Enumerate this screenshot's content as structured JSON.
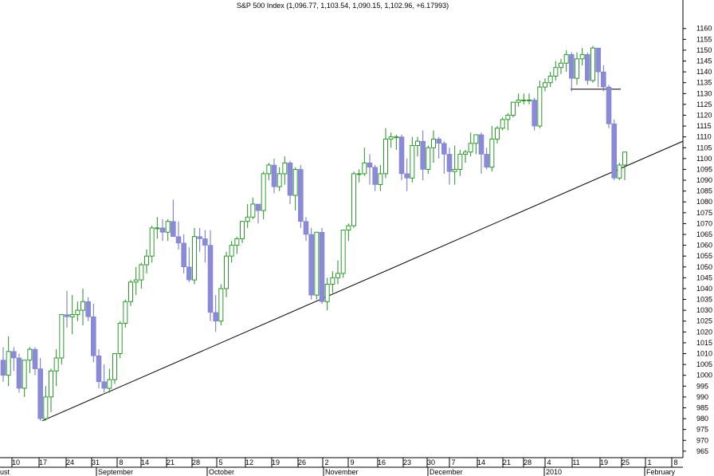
{
  "chart_data": {
    "type": "candlestick",
    "title": "S&P 500 Index (1,096.77, 1,103.54, 1,090.15, 1,102.96, +6.17993)",
    "ylim": [
      962,
      1168
    ],
    "y_ticks": [
      965,
      970,
      975,
      980,
      985,
      990,
      995,
      1000,
      1005,
      1010,
      1015,
      1020,
      1025,
      1030,
      1035,
      1040,
      1045,
      1050,
      1055,
      1060,
      1065,
      1070,
      1075,
      1080,
      1085,
      1090,
      1095,
      1100,
      1105,
      1110,
      1115,
      1120,
      1125,
      1130,
      1135,
      1140,
      1145,
      1150,
      1155,
      1160
    ],
    "x_day_labels": [
      "10",
      "17",
      "24",
      "31",
      "8",
      "14",
      "21",
      "28",
      "5",
      "12",
      "19",
      "26",
      "2",
      "9",
      "16",
      "23",
      "30",
      "7",
      "14",
      "21",
      "28",
      "4",
      "11",
      "19",
      "25",
      "1",
      "8"
    ],
    "x_month_labels": [
      "ust",
      "September",
      "October",
      "November",
      "December",
      "2010",
      "February"
    ],
    "candles": [
      {
        "o": 1007,
        "h": 1013,
        "l": 997,
        "c": 1000
      },
      {
        "o": 1000,
        "h": 1018,
        "l": 995,
        "c": 1011
      },
      {
        "o": 1011,
        "h": 1013,
        "l": 1002,
        "c": 1008
      },
      {
        "o": 1008,
        "h": 1010,
        "l": 992,
        "c": 994
      },
      {
        "o": 994,
        "h": 1007,
        "l": 990,
        "c": 1007
      },
      {
        "o": 1007,
        "h": 1013,
        "l": 1001,
        "c": 1012
      },
      {
        "o": 1012,
        "h": 1013,
        "l": 1000,
        "c": 1003
      },
      {
        "o": 1003,
        "h": 1008,
        "l": 979,
        "c": 980
      },
      {
        "o": 980,
        "h": 995,
        "l": 979,
        "c": 990
      },
      {
        "o": 990,
        "h": 1003,
        "l": 983,
        "c": 1002
      },
      {
        "o": 1002,
        "h": 1012,
        "l": 995,
        "c": 1008
      },
      {
        "o": 1008,
        "h": 1028,
        "l": 1005,
        "c": 1028
      },
      {
        "o": 1028,
        "h": 1039,
        "l": 1022,
        "c": 1027
      },
      {
        "o": 1027,
        "h": 1037,
        "l": 1019,
        "c": 1028
      },
      {
        "o": 1028,
        "h": 1034,
        "l": 1025,
        "c": 1030
      },
      {
        "o": 1030,
        "h": 1040,
        "l": 1023,
        "c": 1034
      },
      {
        "o": 1034,
        "h": 1036,
        "l": 1025,
        "c": 1027
      },
      {
        "o": 1027,
        "h": 1033,
        "l": 1006,
        "c": 1009
      },
      {
        "o": 1009,
        "h": 1012,
        "l": 994,
        "c": 997
      },
      {
        "o": 997,
        "h": 1005,
        "l": 992,
        "c": 994
      },
      {
        "o": 994,
        "h": 1003,
        "l": 992,
        "c": 998
      },
      {
        "o": 998,
        "h": 1010,
        "l": 996,
        "c": 1010
      },
      {
        "o": 1010,
        "h": 1025,
        "l": 1008,
        "c": 1024
      },
      {
        "o": 1024,
        "h": 1035,
        "l": 1022,
        "c": 1034
      },
      {
        "o": 1034,
        "h": 1044,
        "l": 1032,
        "c": 1043
      },
      {
        "o": 1043,
        "h": 1050,
        "l": 1037,
        "c": 1044
      },
      {
        "o": 1044,
        "h": 1052,
        "l": 1040,
        "c": 1051
      },
      {
        "o": 1051,
        "h": 1058,
        "l": 1047,
        "c": 1055
      },
      {
        "o": 1055,
        "h": 1069,
        "l": 1052,
        "c": 1068
      },
      {
        "o": 1068,
        "h": 1073,
        "l": 1063,
        "c": 1068
      },
      {
        "o": 1068,
        "h": 1072,
        "l": 1062,
        "c": 1066
      },
      {
        "o": 1066,
        "h": 1072,
        "l": 1062,
        "c": 1071
      },
      {
        "o": 1071,
        "h": 1081,
        "l": 1064,
        "c": 1064
      },
      {
        "o": 1064,
        "h": 1071,
        "l": 1058,
        "c": 1061
      },
      {
        "o": 1061,
        "h": 1065,
        "l": 1047,
        "c": 1050
      },
      {
        "o": 1050,
        "h": 1059,
        "l": 1043,
        "c": 1044
      },
      {
        "o": 1044,
        "h": 1068,
        "l": 1042,
        "c": 1064
      },
      {
        "o": 1064,
        "h": 1068,
        "l": 1057,
        "c": 1063
      },
      {
        "o": 1063,
        "h": 1067,
        "l": 1052,
        "c": 1060
      },
      {
        "o": 1060,
        "h": 1067,
        "l": 1025,
        "c": 1029
      },
      {
        "o": 1029,
        "h": 1037,
        "l": 1020,
        "c": 1025
      },
      {
        "o": 1025,
        "h": 1042,
        "l": 1023,
        "c": 1040
      },
      {
        "o": 1040,
        "h": 1057,
        "l": 1036,
        "c": 1055
      },
      {
        "o": 1055,
        "h": 1062,
        "l": 1052,
        "c": 1060
      },
      {
        "o": 1060,
        "h": 1064,
        "l": 1056,
        "c": 1063
      },
      {
        "o": 1063,
        "h": 1071,
        "l": 1061,
        "c": 1071
      },
      {
        "o": 1071,
        "h": 1079,
        "l": 1068,
        "c": 1073
      },
      {
        "o": 1073,
        "h": 1082,
        "l": 1072,
        "c": 1079
      },
      {
        "o": 1079,
        "h": 1079,
        "l": 1070,
        "c": 1076
      },
      {
        "o": 1076,
        "h": 1094,
        "l": 1072,
        "c": 1093
      },
      {
        "o": 1093,
        "h": 1098,
        "l": 1090,
        "c": 1097
      },
      {
        "o": 1097,
        "h": 1100,
        "l": 1084,
        "c": 1087
      },
      {
        "o": 1087,
        "h": 1096,
        "l": 1085,
        "c": 1093
      },
      {
        "o": 1093,
        "h": 1101,
        "l": 1088,
        "c": 1098
      },
      {
        "o": 1098,
        "h": 1099,
        "l": 1079,
        "c": 1083
      },
      {
        "o": 1083,
        "h": 1096,
        "l": 1076,
        "c": 1095
      },
      {
        "o": 1095,
        "h": 1097,
        "l": 1068,
        "c": 1071
      },
      {
        "o": 1071,
        "h": 1073,
        "l": 1062,
        "c": 1065
      },
      {
        "o": 1065,
        "h": 1068,
        "l": 1035,
        "c": 1037
      },
      {
        "o": 1037,
        "h": 1066,
        "l": 1035,
        "c": 1066
      },
      {
        "o": 1066,
        "h": 1068,
        "l": 1033,
        "c": 1034
      },
      {
        "o": 1034,
        "h": 1045,
        "l": 1030,
        "c": 1042
      },
      {
        "o": 1042,
        "h": 1048,
        "l": 1038,
        "c": 1045
      },
      {
        "o": 1045,
        "h": 1053,
        "l": 1042,
        "c": 1047
      },
      {
        "o": 1047,
        "h": 1066,
        "l": 1045,
        "c": 1067
      },
      {
        "o": 1067,
        "h": 1070,
        "l": 1062,
        "c": 1069
      },
      {
        "o": 1069,
        "h": 1094,
        "l": 1068,
        "c": 1093
      },
      {
        "o": 1093,
        "h": 1095,
        "l": 1089,
        "c": 1093
      },
      {
        "o": 1093,
        "h": 1105,
        "l": 1092,
        "c": 1098
      },
      {
        "o": 1098,
        "h": 1102,
        "l": 1088,
        "c": 1096
      },
      {
        "o": 1096,
        "h": 1097,
        "l": 1085,
        "c": 1088
      },
      {
        "o": 1088,
        "h": 1097,
        "l": 1085,
        "c": 1093
      },
      {
        "o": 1093,
        "h": 1114,
        "l": 1091,
        "c": 1109
      },
      {
        "o": 1109,
        "h": 1112,
        "l": 1105,
        "c": 1110
      },
      {
        "o": 1110,
        "h": 1111,
        "l": 1104,
        "c": 1110
      },
      {
        "o": 1110,
        "h": 1111,
        "l": 1090,
        "c": 1093
      },
      {
        "o": 1093,
        "h": 1100,
        "l": 1085,
        "c": 1091
      },
      {
        "o": 1091,
        "h": 1110,
        "l": 1089,
        "c": 1106
      },
      {
        "o": 1106,
        "h": 1110,
        "l": 1101,
        "c": 1108
      },
      {
        "o": 1108,
        "h": 1113,
        "l": 1090,
        "c": 1095
      },
      {
        "o": 1095,
        "h": 1106,
        "l": 1093,
        "c": 1105
      },
      {
        "o": 1105,
        "h": 1113,
        "l": 1098,
        "c": 1109
      },
      {
        "o": 1109,
        "h": 1110,
        "l": 1100,
        "c": 1107
      },
      {
        "o": 1107,
        "h": 1108,
        "l": 1093,
        "c": 1102
      },
      {
        "o": 1102,
        "h": 1105,
        "l": 1088,
        "c": 1094
      },
      {
        "o": 1094,
        "h": 1106,
        "l": 1088,
        "c": 1095
      },
      {
        "o": 1095,
        "h": 1104,
        "l": 1092,
        "c": 1102
      },
      {
        "o": 1102,
        "h": 1104,
        "l": 1098,
        "c": 1103
      },
      {
        "o": 1103,
        "h": 1112,
        "l": 1101,
        "c": 1107
      },
      {
        "o": 1107,
        "h": 1111,
        "l": 1102,
        "c": 1111
      },
      {
        "o": 1111,
        "h": 1112,
        "l": 1093,
        "c": 1102
      },
      {
        "o": 1102,
        "h": 1105,
        "l": 1095,
        "c": 1096
      },
      {
        "o": 1096,
        "h": 1115,
        "l": 1094,
        "c": 1109
      },
      {
        "o": 1109,
        "h": 1115,
        "l": 1107,
        "c": 1114
      },
      {
        "o": 1114,
        "h": 1119,
        "l": 1113,
        "c": 1118
      },
      {
        "o": 1118,
        "h": 1121,
        "l": 1113,
        "c": 1120
      },
      {
        "o": 1120,
        "h": 1126,
        "l": 1119,
        "c": 1126
      },
      {
        "o": 1126,
        "h": 1130,
        "l": 1124,
        "c": 1127
      },
      {
        "o": 1127,
        "h": 1130,
        "l": 1125,
        "c": 1127
      },
      {
        "o": 1127,
        "h": 1130,
        "l": 1125,
        "c": 1127
      },
      {
        "o": 1127,
        "h": 1128,
        "l": 1113,
        "c": 1115
      },
      {
        "o": 1115,
        "h": 1136,
        "l": 1114,
        "c": 1133
      },
      {
        "o": 1133,
        "h": 1137,
        "l": 1131,
        "c": 1135
      },
      {
        "o": 1135,
        "h": 1140,
        "l": 1133,
        "c": 1138
      },
      {
        "o": 1138,
        "h": 1145,
        "l": 1136,
        "c": 1142
      },
      {
        "o": 1142,
        "h": 1146,
        "l": 1139,
        "c": 1144
      },
      {
        "o": 1144,
        "h": 1150,
        "l": 1140,
        "c": 1148
      },
      {
        "o": 1148,
        "h": 1149,
        "l": 1131,
        "c": 1137
      },
      {
        "o": 1137,
        "h": 1149,
        "l": 1134,
        "c": 1146
      },
      {
        "o": 1146,
        "h": 1151,
        "l": 1143,
        "c": 1148
      },
      {
        "o": 1148,
        "h": 1149,
        "l": 1134,
        "c": 1136
      },
      {
        "o": 1136,
        "h": 1152,
        "l": 1135,
        "c": 1151
      },
      {
        "o": 1151,
        "h": 1151,
        "l": 1133,
        "c": 1140
      },
      {
        "o": 1140,
        "h": 1143,
        "l": 1131,
        "c": 1133
      },
      {
        "o": 1133,
        "h": 1134,
        "l": 1114,
        "c": 1116
      },
      {
        "o": 1116,
        "h": 1118,
        "l": 1090,
        "c": 1091
      },
      {
        "o": 1091,
        "h": 1098,
        "l": 1090,
        "c": 1097
      },
      {
        "o": 1097,
        "h": 1103,
        "l": 1090,
        "c": 1103
      }
    ]
  }
}
